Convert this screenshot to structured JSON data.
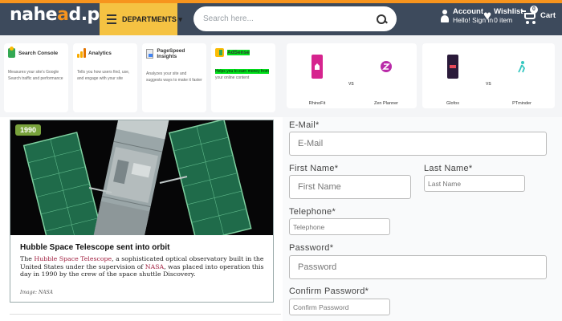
{
  "header": {
    "logo_main": "nahe",
    "logo_accent": "a",
    "logo_tail": "d.pk",
    "departments_label": "DEPARTMENTS ▾",
    "search_placeholder": "Search here...",
    "account_title": "Account",
    "account_sub": "Hello! Sign in",
    "wishlist_title": "Wishlist",
    "wishlist_sub": "0 item",
    "cart_label": "Cart",
    "cart_count": "0"
  },
  "tools": [
    {
      "name": "Search Console",
      "icon": "search-console-icon",
      "desc": "Measures your site's Google Search traffic and performance"
    },
    {
      "name": "Analytics",
      "icon": "analytics-icon",
      "desc": "Tells you how users find, use, and engage with your site"
    },
    {
      "name": "PageSpeed Insights",
      "icon": "pagespeed-icon",
      "desc": "Analyzes your site and suggests ways to make it faster"
    },
    {
      "name": "AdSense",
      "icon": "adsense-icon",
      "desc_highlight": "Helps you to earn money from",
      "desc": "your online content"
    }
  ],
  "comparisons": [
    {
      "left": {
        "name": "RhinoFit",
        "color": "#d6248e"
      },
      "right": {
        "name": "Zen Planner",
        "color": "#b92aa8"
      },
      "vs": "VS"
    },
    {
      "left": {
        "name": "Glofox",
        "color": "#2a1a3a"
      },
      "right": {
        "name": "PTminder",
        "color": "#35c7c0"
      },
      "vs": "VS"
    }
  ],
  "article": {
    "year": "1990",
    "title": "Hubble Space Telescope sent into orbit",
    "text_pre": "The ",
    "link1": "Hubble Space Telescope",
    "text_mid": ", a sophisticated optical observatory built in the United States under the supervision of ",
    "link2": "NASA",
    "text_post": ", was placed into operation this day in 1990 by the crew of the space shuttle Discovery.",
    "credit": "Image: NASA"
  },
  "form": {
    "email_label": "E-Mail*",
    "email_placeholder": "E-Mail",
    "first_name_label": "First Name*",
    "first_name_placeholder": "First Name",
    "last_name_label": "Last Name*",
    "last_name_placeholder": "Last Name",
    "telephone_label": "Telephone*",
    "telephone_placeholder": "Telephone",
    "password_label": "Password*",
    "password_placeholder": "Password",
    "confirm_label": "Confirm Password*",
    "confirm_placeholder": "Confirm Password"
  }
}
